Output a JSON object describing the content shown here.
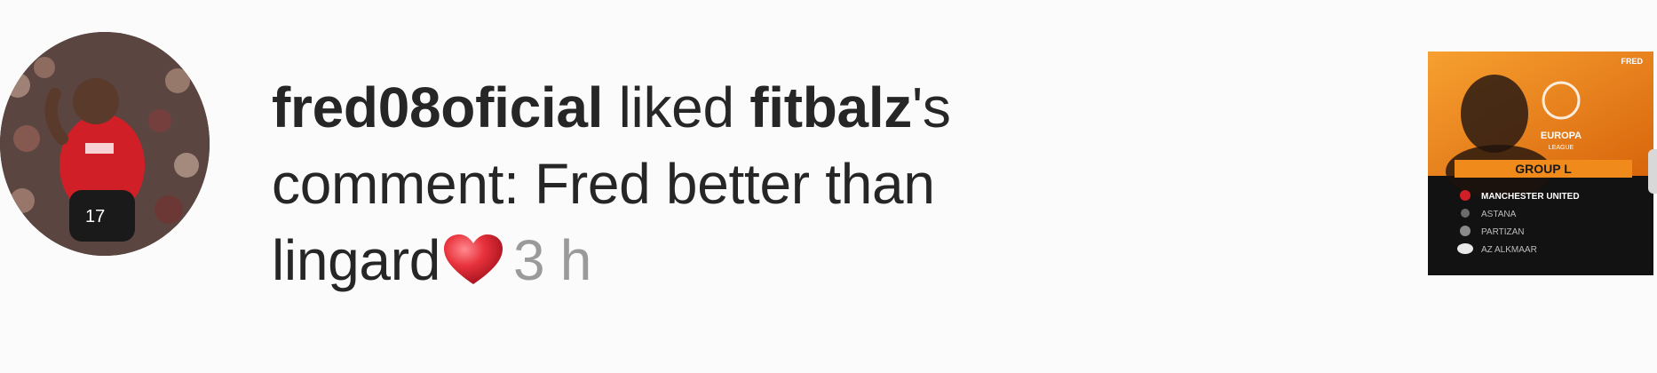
{
  "notification": {
    "actor": "fred08oficial",
    "action_pre": " liked ",
    "target": "fitbalz",
    "action_post": "'s",
    "comment_intro": "comment: Fred better than",
    "comment_tail": "lingard",
    "time": "3 h",
    "emoji_icon": "heart-emoji-icon"
  },
  "avatar": {
    "icon": "profile-photo-player-17"
  },
  "thumbnail": {
    "corner_text": "FRED",
    "logo_text": "EUROPA",
    "logo_sub": "LEAGUE",
    "group": "GROUP L",
    "teams": [
      "MANCHESTER UNITED",
      "ASTANA",
      "PARTIZAN",
      "AZ ALKMAAR"
    ]
  },
  "colors": {
    "text": "#262626",
    "muted": "#9a9a9a",
    "accent_orange": "#f08a1a",
    "heart": "#e8323c"
  }
}
